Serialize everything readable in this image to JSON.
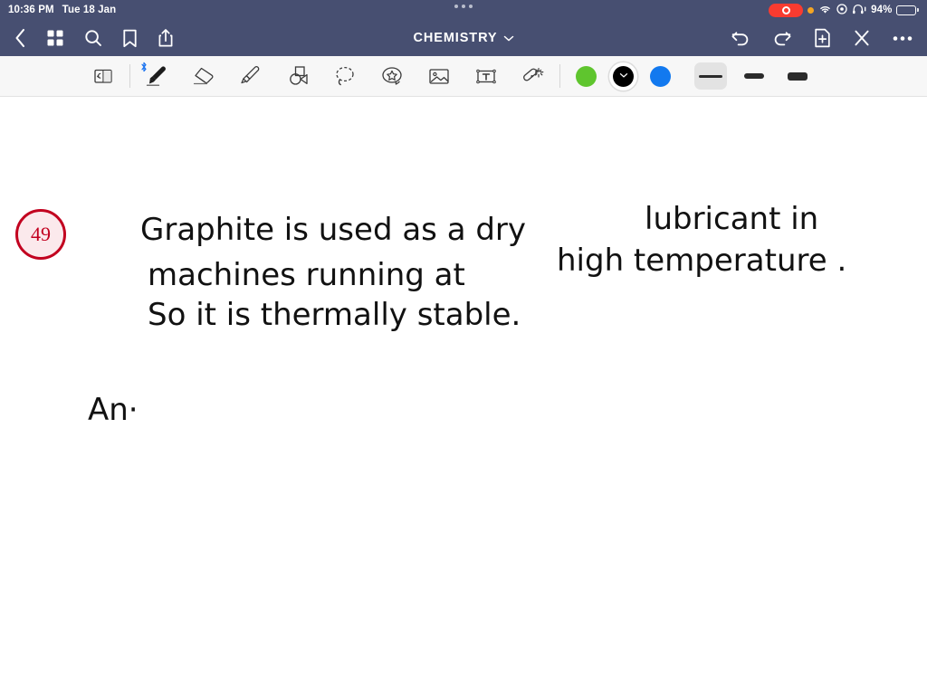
{
  "status_bar": {
    "time": "10:36 PM",
    "date": "Tue 18 Jan",
    "battery_percent": "94%",
    "icons": [
      "screen-recording-pill",
      "orange-privacy-dot",
      "wifi-icon",
      "location-icon",
      "headphones-icon",
      "battery-icon"
    ]
  },
  "nav_bar": {
    "title": "CHEMISTRY",
    "left_buttons": [
      {
        "name": "back-button",
        "icon": "chevron-left-icon"
      },
      {
        "name": "thumbnails-button",
        "icon": "grid-icon"
      },
      {
        "name": "search-button",
        "icon": "search-icon"
      },
      {
        "name": "bookmark-button",
        "icon": "bookmark-icon"
      },
      {
        "name": "share-button",
        "icon": "share-icon"
      }
    ],
    "right_buttons": [
      {
        "name": "undo-button",
        "icon": "undo-icon"
      },
      {
        "name": "redo-button",
        "icon": "redo-icon"
      },
      {
        "name": "add-page-button",
        "icon": "document-plus-icon"
      },
      {
        "name": "close-button",
        "icon": "close-x-icon"
      },
      {
        "name": "more-button",
        "icon": "ellipsis-icon"
      }
    ]
  },
  "toolbar": {
    "tools": [
      {
        "name": "page-flip-tool",
        "icon": "page-flip-icon",
        "selected": false
      },
      {
        "name": "pen-tool",
        "icon": "pen-icon",
        "selected": true,
        "bluetooth": "ʙ"
      },
      {
        "name": "eraser-tool",
        "icon": "eraser-icon",
        "selected": false
      },
      {
        "name": "highlighter-tool",
        "icon": "highlighter-icon",
        "selected": false
      },
      {
        "name": "shapes-tool",
        "icon": "shapes-icon",
        "selected": false
      },
      {
        "name": "lasso-tool",
        "icon": "lasso-icon",
        "selected": false
      },
      {
        "name": "sticker-tool",
        "icon": "sticker-star-icon",
        "selected": false
      },
      {
        "name": "image-tool",
        "icon": "image-icon",
        "selected": false
      },
      {
        "name": "text-tool",
        "icon": "text-box-icon",
        "selected": false
      },
      {
        "name": "magic-wand-tool",
        "icon": "magic-wand-icon",
        "selected": false
      }
    ],
    "colors": [
      {
        "name": "color-green",
        "hex": "#5fc52e",
        "selected": false
      },
      {
        "name": "color-black",
        "hex": "#000000",
        "selected": true
      },
      {
        "name": "color-blue",
        "hex": "#1279ef",
        "selected": false
      }
    ],
    "stroke_widths": [
      {
        "name": "stroke-thin",
        "selected": true
      },
      {
        "name": "stroke-medium",
        "selected": false
      },
      {
        "name": "stroke-thick",
        "selected": false
      }
    ]
  },
  "canvas": {
    "page_number": "49",
    "handwriting": {
      "line1a": "Graphite  is  used  as  a  dry",
      "line1b": "lubricant in",
      "line2a": "machines   running   at",
      "line2b": "high  temperature .",
      "line3": "So  it  is  thermally  stable.",
      "line4": "An·"
    }
  },
  "colors": {
    "navbar_bg": "#474f71",
    "toolbar_bg": "#f7f7f7",
    "canvas_bg": "#ffffff",
    "badge_ring": "#c2001f",
    "badge_fill": "#fbe9ec",
    "ink": "#111111",
    "bluetooth_blue": "#1a73f0"
  }
}
